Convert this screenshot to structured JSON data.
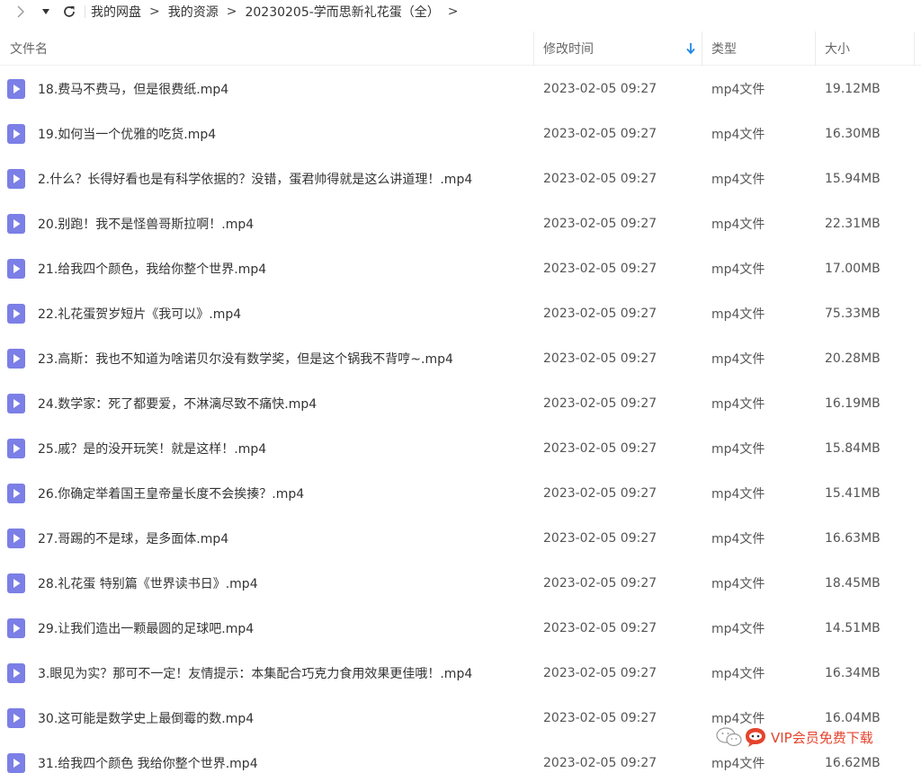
{
  "toolbar": {
    "breadcrumbs": [
      "我的网盘",
      "我的资源",
      "20230205-学而思新礼花蛋（全）"
    ],
    "icons": [
      "forward-arrow-icon",
      "dropdown-arrow-icon",
      "refresh-icon",
      "chevron-right-icon"
    ]
  },
  "columns": {
    "name": "文件名",
    "modified": "修改时间",
    "type": "类型",
    "size": "大小"
  },
  "colors": {
    "accent": "#1e88e5",
    "file_icon": "#7b7fe6",
    "watermark": "#e5432d"
  },
  "files": [
    {
      "name": "18.费马不费马，但是很费纸.mp4",
      "modified": "2023-02-05 09:27",
      "type": "mp4文件",
      "size": "19.12MB"
    },
    {
      "name": "19.如何当一个优雅的吃货.mp4",
      "modified": "2023-02-05 09:27",
      "type": "mp4文件",
      "size": "16.30MB"
    },
    {
      "name": "2.什么？长得好看也是有科学依据的？没错，蛋君帅得就是这么讲道理！.mp4",
      "modified": "2023-02-05 09:27",
      "type": "mp4文件",
      "size": "15.94MB"
    },
    {
      "name": "20.别跑！我不是怪兽哥斯拉啊！.mp4",
      "modified": "2023-02-05 09:27",
      "type": "mp4文件",
      "size": "22.31MB"
    },
    {
      "name": "21.给我四个颜色，我给你整个世界.mp4",
      "modified": "2023-02-05 09:27",
      "type": "mp4文件",
      "size": "17.00MB"
    },
    {
      "name": "22.礼花蛋贺岁短片《我可以》.mp4",
      "modified": "2023-02-05 09:27",
      "type": "mp4文件",
      "size": "75.33MB"
    },
    {
      "name": "23.高斯：我也不知道为啥诺贝尔没有数学奖，但是这个锅我不背哼~.mp4",
      "modified": "2023-02-05 09:27",
      "type": "mp4文件",
      "size": "20.28MB"
    },
    {
      "name": "24.数学家：死了都要爱，不淋漓尽致不痛快.mp4",
      "modified": "2023-02-05 09:27",
      "type": "mp4文件",
      "size": "16.19MB"
    },
    {
      "name": "25.戚？是的没开玩笑！就是这样！.mp4",
      "modified": "2023-02-05 09:27",
      "type": "mp4文件",
      "size": "15.84MB"
    },
    {
      "name": "26.你确定举着国王皇帝量长度不会挨揍？.mp4",
      "modified": "2023-02-05 09:27",
      "type": "mp4文件",
      "size": "15.41MB"
    },
    {
      "name": "27.哥踢的不是球，是多面体.mp4",
      "modified": "2023-02-05 09:27",
      "type": "mp4文件",
      "size": "16.63MB"
    },
    {
      "name": "28.礼花蛋 特别篇《世界读书日》.mp4",
      "modified": "2023-02-05 09:27",
      "type": "mp4文件",
      "size": "18.45MB"
    },
    {
      "name": "29.让我们造出一颗最圆的足球吧.mp4",
      "modified": "2023-02-05 09:27",
      "type": "mp4文件",
      "size": "14.51MB"
    },
    {
      "name": "3.眼见为实？那可不一定！友情提示：本集配合巧克力食用效果更佳哦！.mp4",
      "modified": "2023-02-05 09:27",
      "type": "mp4文件",
      "size": "16.34MB"
    },
    {
      "name": "30.这可能是数学史上最倒霉的数.mp4",
      "modified": "2023-02-05 09:27",
      "type": "mp4文件",
      "size": "16.04MB"
    },
    {
      "name": "31.给我四个颜色 我给你整个世界.mp4",
      "modified": "2023-02-05 09:27",
      "type": "mp4文件",
      "size": "16.62MB"
    }
  ],
  "watermark": {
    "text": "VIP会员免费下载",
    "icons": [
      "wechat-icon",
      "chat-bubble-icon"
    ]
  }
}
